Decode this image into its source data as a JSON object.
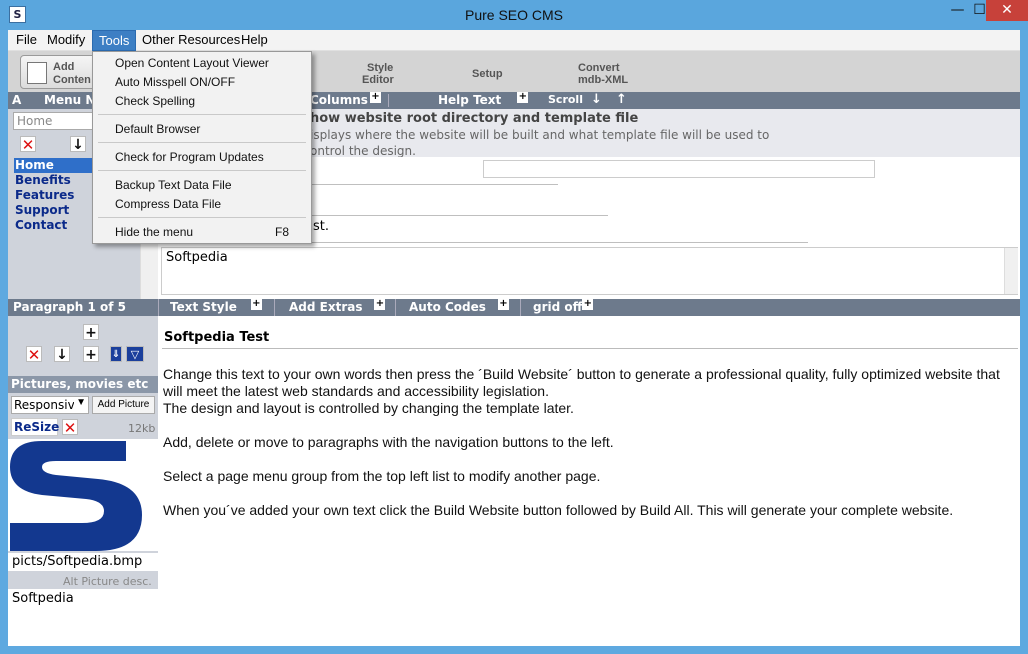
{
  "window": {
    "title": "Pure SEO CMS",
    "minimize_glyph": "—",
    "maximize_glyph": "☐",
    "close_glyph": "✕"
  },
  "menubar": [
    "File",
    "Modify",
    "Tools",
    "Other Resources",
    "Help"
  ],
  "toolbar": {
    "add_line1": "Add",
    "add_line2": "Conten",
    "style_line1": "Style",
    "style_line2": "Editor",
    "setup": "Setup",
    "convert_line1": "Convert",
    "convert_line2": "mdb-XML"
  },
  "tools_menu": {
    "items": [
      "Open Content Layout Viewer",
      "Auto Misspell ON/OFF",
      "Check Spelling",
      "Default Browser",
      "Check for Program Updates",
      "Backup Text Data File",
      "Compress Data File",
      "Hide the menu"
    ],
    "hide_shortcut": "F8"
  },
  "top_bar": {
    "left_a": "A",
    "menu_n": "Menu N",
    "columns": "Columns",
    "help_text": "Help Text",
    "scroll": "Scroll",
    "scroll_down": "↓",
    "scroll_up": "↑"
  },
  "left_panel": {
    "page_input": "Home",
    "nav": [
      "Home",
      "Benefits",
      "Features",
      "Support",
      "Contact"
    ]
  },
  "description": {
    "title": "how website root directory and template file",
    "line1": "isplays where the website will be built and what template file will be used to",
    "line2": "ontrol the design."
  },
  "content_top": {
    "fragment": "st.",
    "textarea_value": "Softpedia"
  },
  "para_bar": {
    "paragraph": "Paragraph 1 of 5",
    "text_style": "Text Style",
    "add_extras": "Add Extras",
    "auto_codes": "Auto Codes",
    "grid": "grid off"
  },
  "pictures": {
    "header": "Pictures, movies etc",
    "select_value": "Responsive",
    "add_picture": "Add Picture",
    "resize": "ReSize",
    "size": "12kb",
    "file_path": "picts/Softpedia.bmp",
    "alt_label": "Alt Picture desc.",
    "alt_value": "Softpedia"
  },
  "main": {
    "heading": "Softpedia Test",
    "paragraphs": [
      "Change this text to your own words then press the ´Build Website´ button to generate a professional quality,  fully optimized website that will meet the latest web standards and accessibility legislation.",
      "The design and layout is controlled by changing the template later.",
      "Add, delete or move to paragraphs with the navigation buttons to the left.",
      "Select a page menu group from the top left list to modify another page.",
      "When you´ve added your own text click the Build Website button followed by Build All. This will generate your complete website."
    ]
  },
  "colors": {
    "titlebar": "#5aa6dd",
    "close_button": "#c7413a",
    "menu_active": "#3d7fc4",
    "bar_dark": "#6d7a8c",
    "nav_link": "#0b2a8a",
    "logo_blue": "#13388f"
  }
}
